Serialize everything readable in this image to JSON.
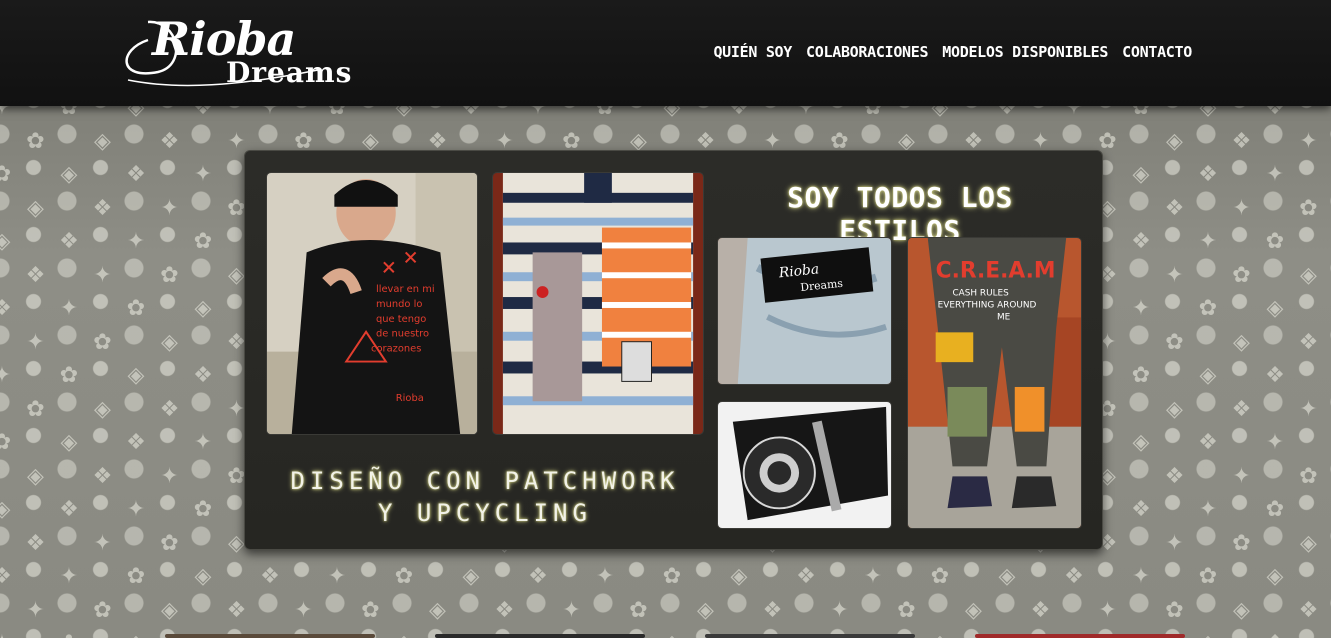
{
  "header": {
    "logo_top": "Rioba",
    "logo_bottom": "Dreams",
    "nav": [
      {
        "label": "QUIÉN SOY"
      },
      {
        "label": "COLABORACIONES"
      },
      {
        "label": "MODELOS DISPONIBLES"
      },
      {
        "label": "CONTACTO"
      }
    ]
  },
  "hero": {
    "title_right": "SOY TODOS LOS ESTILOS",
    "title_left_line1": "DISEÑO CON PATCHWORK",
    "title_left_line2": "Y UPCYCLING",
    "photos": {
      "jacket_text": "llevar en mi mundo lo que tengo de nuestro corazones",
      "jeans_patch": "Rioba Dreams",
      "cream_text": "C.R.E.A.M",
      "cream_sub": "CASH RULES EVERYTHING AROUND ME"
    }
  },
  "colors": {
    "header_bg": "#141414",
    "card_bg": "#2a2a26",
    "page_bg": "#8a8a82",
    "accent_glow": "#d8d88a"
  }
}
